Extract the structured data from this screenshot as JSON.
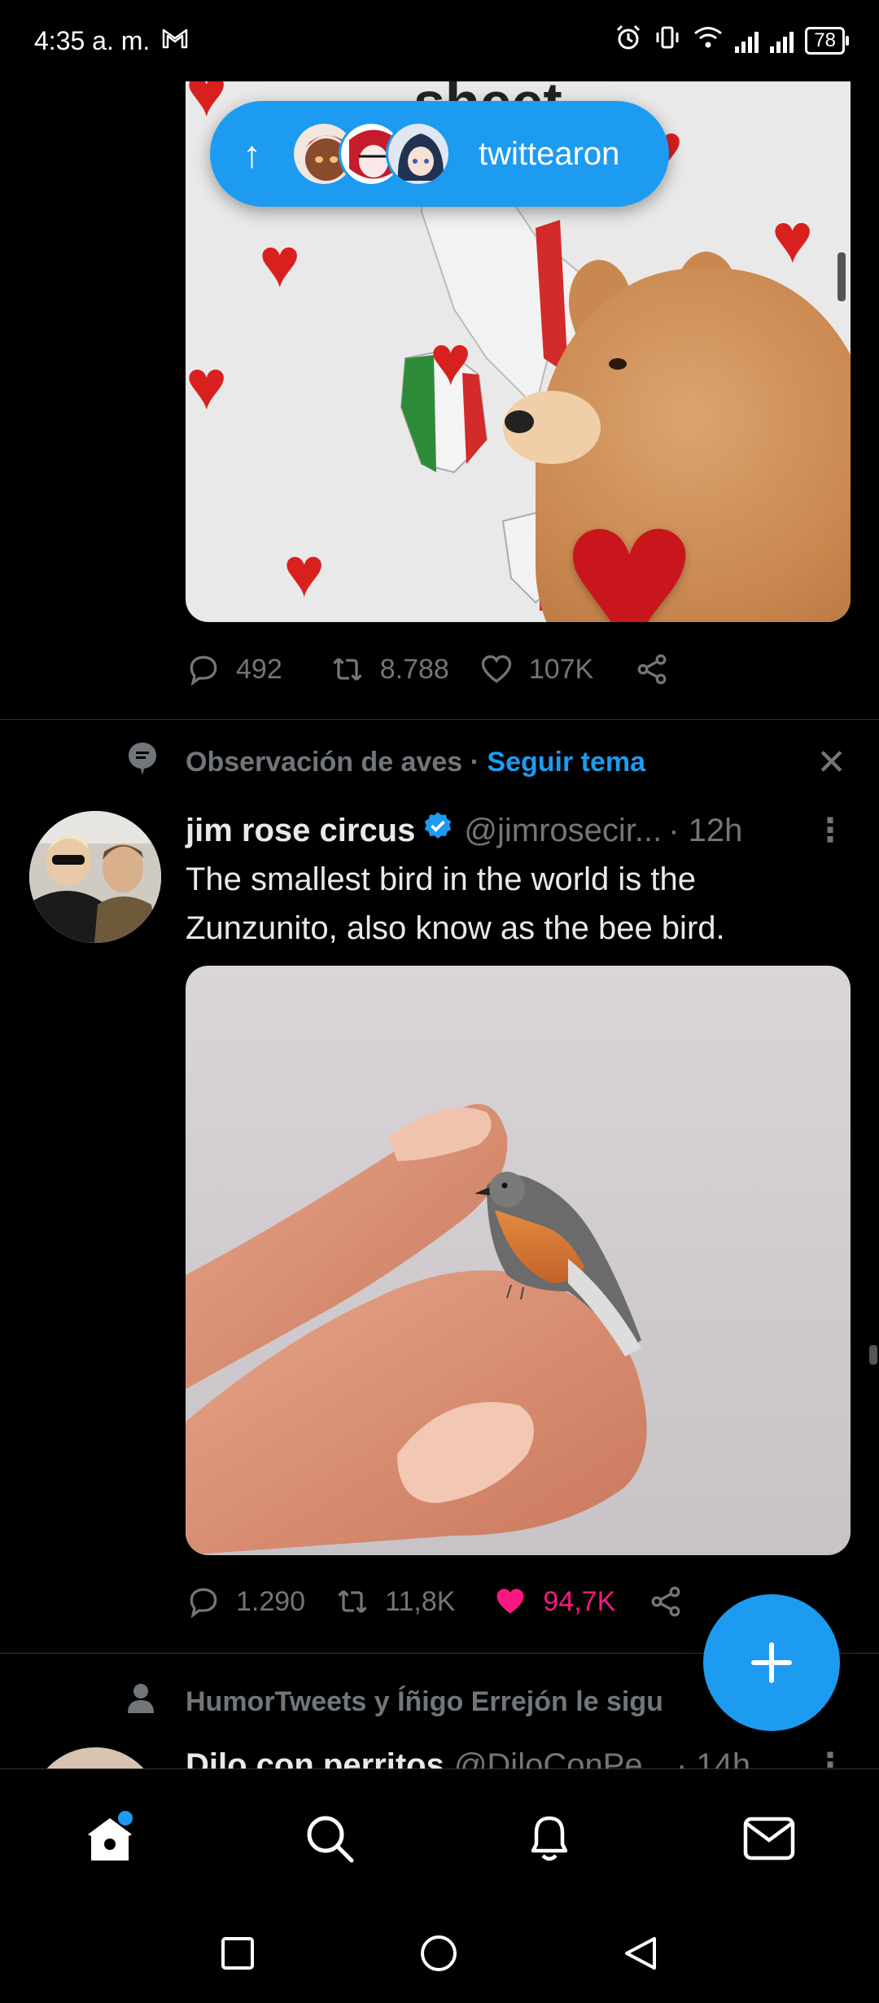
{
  "status_bar": {
    "time": "4:35 a. m.",
    "battery": "78"
  },
  "new_tweets_pill": {
    "label": "twittearon"
  },
  "tweet1": {
    "image_caption_text": "sheet",
    "replies": "492",
    "retweets": "8.788",
    "likes": "107K"
  },
  "tweet2": {
    "topic_label": "Observación de aves",
    "topic_separator": "·",
    "follow_topic": "Seguir tema",
    "display_name": "jim rose circus",
    "handle": "@jimrosecir...",
    "time": "· 12h",
    "text_line1": "The smallest bird in the world is the",
    "text_line2": "Zunzunito, also know as the bee bird.",
    "replies": "1.290",
    "retweets": "11,8K",
    "likes": "94,7K",
    "liked": true
  },
  "tweet3": {
    "social_context": "HumorTweets y Íñigo Errejón le sigu",
    "display_name": "Dilo con perritos",
    "handle": "@DiloConPe...",
    "time": "· 14h"
  },
  "nav": {
    "items": [
      "home-icon",
      "search-icon",
      "bell-icon",
      "mail-icon"
    ]
  },
  "colors": {
    "accent": "#1d9bf0",
    "like": "#f91880",
    "muted": "#71767b"
  }
}
